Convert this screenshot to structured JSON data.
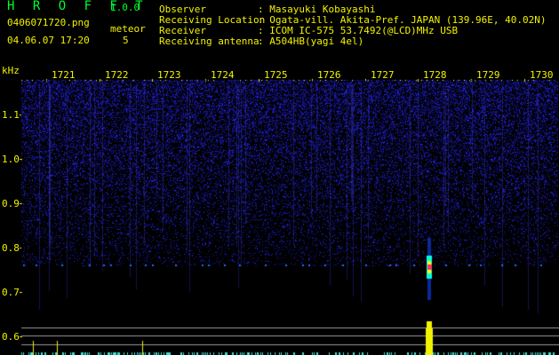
{
  "app": {
    "name": "H R O F F T",
    "version": "1.0.0",
    "filename": "0406071720.png",
    "datetime": "04.06.07 17:20",
    "meteor_label": "meteor",
    "meteor_count": "5"
  },
  "info": [
    {
      "key": "Observer",
      "value": ": Masayuki Kobayashi"
    },
    {
      "key": "Receiving Location",
      "value": ": Ogata-vill. Akita-Pref. JAPAN (139.96E, 40.02N)"
    },
    {
      "key": "Receiver",
      "value": ": ICOM IC-575 53.7492(@LCD)MHz USB"
    },
    {
      "key": "Receiving antenna",
      "value": ": A504HB(yagi 4el)"
    }
  ],
  "axis": {
    "y_unit": "kHz",
    "y_ticks": [
      "1.1",
      "1.0",
      "0.9",
      "0.8",
      "0.7",
      "0.6"
    ],
    "x_ticks": [
      "1721",
      "1722",
      "1723",
      "1724",
      "1725",
      "1726",
      "1727",
      "1728",
      "1729",
      "1730"
    ]
  },
  "colors": {
    "text_yellow": "#f2f200",
    "title_green": "#00ff2a",
    "noise_blue": "#1a1aff",
    "signal_line": "#1e6bff",
    "meteor_core": "#ff3366",
    "meteor_halo": "#00ffdd",
    "bottom_bar": "#f2f200"
  }
}
